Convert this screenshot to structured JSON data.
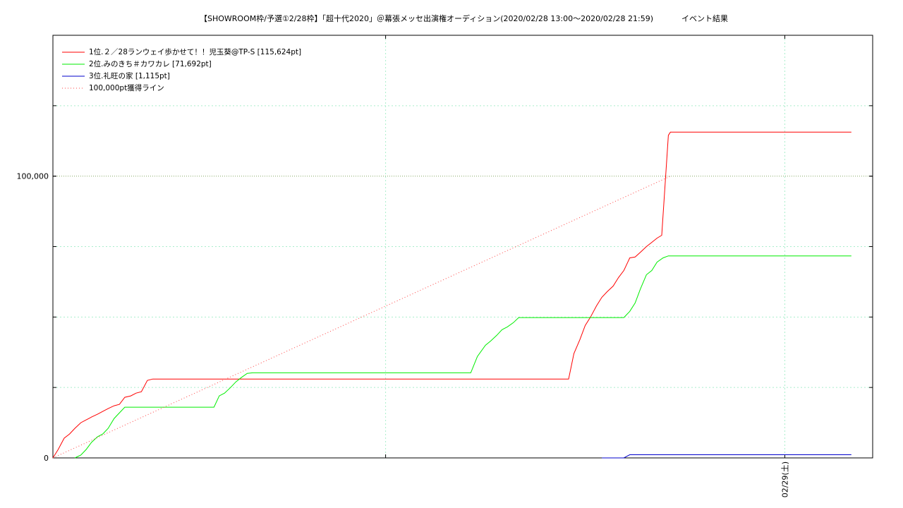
{
  "chart_data": {
    "type": "line",
    "title": "【SHOWROOM枠/予選①2/28枠】「超十代2020」＠幕張メッセ出演権オーディション(2020/02/28 13:00〜2020/02/28 21:59)",
    "subtitle": "イベント結果",
    "xlabel": "",
    "ylabel": "",
    "x_unit": "hours since 2020/02/28 13:00",
    "xlim": [
      0,
      12.32
    ],
    "ylim": [
      0,
      150000
    ],
    "grid": true,
    "legend_position": "top-left",
    "x_ticks": [
      {
        "x": 11,
        "label": "02/29(土)"
      }
    ],
    "y_ticks": [
      {
        "y": 0,
        "label": "0"
      },
      {
        "y": 100000,
        "label": "100,000"
      }
    ],
    "series": [
      {
        "name": "1位.２／28ランウェイ歩かせて！！児玉葵@TP-S [115,624pt]",
        "color": "#ff0000",
        "style": "solid",
        "points": [
          [
            0.0,
            0
          ],
          [
            0.08,
            3000
          ],
          [
            0.17,
            7000
          ],
          [
            0.25,
            8500
          ],
          [
            0.33,
            10500
          ],
          [
            0.42,
            12500
          ],
          [
            0.5,
            13500
          ],
          [
            0.58,
            14500
          ],
          [
            0.67,
            15500
          ],
          [
            0.75,
            16500
          ],
          [
            0.83,
            17500
          ],
          [
            0.92,
            18500
          ],
          [
            1.0,
            19000
          ],
          [
            1.08,
            21500
          ],
          [
            1.17,
            22000
          ],
          [
            1.25,
            23000
          ],
          [
            1.33,
            23500
          ],
          [
            1.42,
            27500
          ],
          [
            1.5,
            28000
          ],
          [
            2.0,
            28000
          ],
          [
            3.0,
            28000
          ],
          [
            5.0,
            28000
          ],
          [
            7.0,
            28000
          ],
          [
            7.75,
            28000
          ],
          [
            7.83,
            37000
          ],
          [
            7.92,
            42000
          ],
          [
            8.0,
            47000
          ],
          [
            8.08,
            50000
          ],
          [
            8.17,
            54000
          ],
          [
            8.25,
            57000
          ],
          [
            8.33,
            59000
          ],
          [
            8.42,
            61000
          ],
          [
            8.5,
            64000
          ],
          [
            8.58,
            66500
          ],
          [
            8.67,
            71000
          ],
          [
            8.75,
            71300
          ],
          [
            8.83,
            73000
          ],
          [
            8.92,
            75000
          ],
          [
            9.0,
            76500
          ],
          [
            9.08,
            78000
          ],
          [
            9.15,
            79000
          ],
          [
            9.25,
            114500
          ],
          [
            9.28,
            115624
          ],
          [
            12.0,
            115624
          ]
        ]
      },
      {
        "name": "2位.みのきち＃カワカレ [71,692pt]",
        "color": "#00ee00",
        "style": "solid",
        "points": [
          [
            0.33,
            0
          ],
          [
            0.42,
            1000
          ],
          [
            0.5,
            3000
          ],
          [
            0.58,
            5500
          ],
          [
            0.67,
            7500
          ],
          [
            0.75,
            8500
          ],
          [
            0.83,
            10500
          ],
          [
            0.92,
            14000
          ],
          [
            1.0,
            16000
          ],
          [
            1.08,
            18000
          ],
          [
            1.17,
            18000
          ],
          [
            2.0,
            18000
          ],
          [
            2.42,
            18000
          ],
          [
            2.5,
            22000
          ],
          [
            2.58,
            23000
          ],
          [
            2.67,
            25000
          ],
          [
            2.75,
            27000
          ],
          [
            2.83,
            28500
          ],
          [
            2.92,
            30000
          ],
          [
            3.0,
            30200
          ],
          [
            5.0,
            30200
          ],
          [
            6.28,
            30200
          ],
          [
            6.38,
            36000
          ],
          [
            6.5,
            40000
          ],
          [
            6.58,
            41500
          ],
          [
            6.67,
            43500
          ],
          [
            6.75,
            45500
          ],
          [
            6.83,
            46500
          ],
          [
            6.92,
            48000
          ],
          [
            7.0,
            49800
          ],
          [
            7.5,
            49800
          ],
          [
            8.0,
            49800
          ],
          [
            8.58,
            49800
          ],
          [
            8.67,
            52000
          ],
          [
            8.75,
            55000
          ],
          [
            8.83,
            60000
          ],
          [
            8.92,
            65000
          ],
          [
            9.0,
            66500
          ],
          [
            9.08,
            69500
          ],
          [
            9.17,
            71000
          ],
          [
            9.25,
            71692
          ],
          [
            12.0,
            71692
          ]
        ]
      },
      {
        "name": "3位.礼旺の家 [1,115pt]",
        "color": "#0000cc",
        "style": "solid",
        "points": [
          [
            8.25,
            0
          ],
          [
            8.58,
            0
          ],
          [
            8.67,
            1115
          ],
          [
            12.0,
            1115
          ]
        ]
      },
      {
        "name": "100,000pt獲得ライン",
        "color": "#ff4444",
        "style": "dotted",
        "points": [
          [
            0.0,
            0
          ],
          [
            9.28,
            100000
          ]
        ]
      }
    ]
  }
}
